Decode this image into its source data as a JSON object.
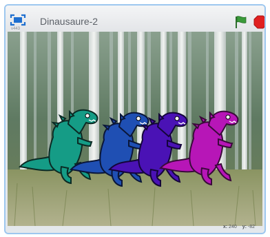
{
  "header": {
    "version": "v443",
    "project_title": "Dinausaure-2"
  },
  "icons": {
    "fullscreen": "fullscreen-icon",
    "green_flag": "green-flag-icon",
    "stop": "stop-icon"
  },
  "stage": {
    "sprites": [
      {
        "name": "dinosaur-teal",
        "color": "#159c86"
      },
      {
        "name": "dinosaur-blue",
        "color": "#1f4fb3"
      },
      {
        "name": "dinosaur-purple",
        "color": "#4a12b5"
      },
      {
        "name": "dinosaur-magenta",
        "color": "#b716b7"
      }
    ]
  },
  "coords": {
    "x_label": "x:",
    "x_value": "240",
    "y_label": "y:",
    "y_value": "-82"
  },
  "colors": {
    "accent": "#9dc7ef",
    "flag": "#3a9a3a",
    "stop": "#e02020"
  }
}
